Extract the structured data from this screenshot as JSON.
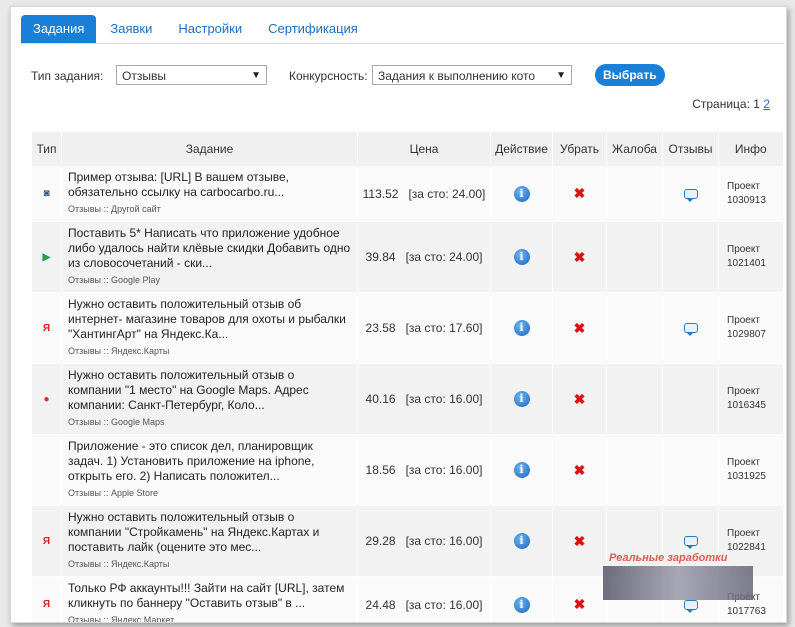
{
  "tabs": [
    {
      "label": "Задания",
      "active": true
    },
    {
      "label": "Заявки",
      "active": false
    },
    {
      "label": "Настройки",
      "active": false
    },
    {
      "label": "Сертификация",
      "active": false
    }
  ],
  "filters": {
    "type_label": "Тип задания:",
    "type_value": "Отзывы",
    "competition_label": "Конкурсность:",
    "competition_value": "Задания к выполнению кото",
    "submit_label": "Выбрать"
  },
  "pagination": {
    "label": "Страница:",
    "current": "1",
    "next": "2"
  },
  "table": {
    "headers": [
      "Тип",
      "Задание",
      "Цена",
      "Действие",
      "Убрать",
      "Жалоба",
      "Отзывы",
      "Инфо"
    ],
    "rows": [
      {
        "icon": "other-site-icon",
        "icon_glyph": "◙",
        "icon_color": "#3a5a8c",
        "text": "Пример отзыва: [URL] В вашем отзыве, обязательно ссылку на carbocarbo.ru...",
        "category": "Отзывы :: Другой сайт",
        "price": "113.52",
        "per100": "[за сто: 24.00]",
        "has_reviews": true,
        "project": "Проект",
        "project_id": "1030913"
      },
      {
        "icon": "google-play-icon",
        "icon_glyph": "▶",
        "icon_color": "#2a9d4a",
        "text": "Поставить 5* Написать что приложение удобное либо удалось найти клёвые скидки Добавить одно из словосочетаний - ски...",
        "category": "Отзывы :: Google Play",
        "price": "39.84",
        "per100": "[за сто: 24.00]",
        "has_reviews": false,
        "project": "Проект",
        "project_id": "1021401"
      },
      {
        "icon": "yandex-icon",
        "icon_glyph": "Я",
        "icon_color": "#e02020",
        "text": "Нужно оставить положительный отзыв об интернет- магазине товаров для охоты и рыбалки \"ХантингАрт\" на Яндекс.Ка...",
        "category": "Отзывы :: Яндекс.Карты",
        "price": "23.58",
        "per100": "[за сто: 17.60]",
        "has_reviews": true,
        "project": "Проект",
        "project_id": "1029807"
      },
      {
        "icon": "map-pin-icon",
        "icon_glyph": "●",
        "icon_color": "#d93025",
        "text": "Нужно оставить положительный отзыв о компании \"1 место\" на Google Maps. Адрес компании: Санкт-Петербург, Коло...",
        "category": "Отзывы :: Google Maps",
        "price": "40.16",
        "per100": "[за сто: 16.00]",
        "has_reviews": false,
        "project": "Проект",
        "project_id": "1016345"
      },
      {
        "icon": "apple-icon",
        "icon_glyph": "",
        "icon_color": "#222222",
        "text": "Приложение - это список дел, планировщик задач. 1) Установить приложение на iphone, открыть его. 2) Написать положител...",
        "category": "Отзывы :: Apple Store",
        "price": "18.56",
        "per100": "[за сто: 16.00]",
        "has_reviews": false,
        "project": "Проект",
        "project_id": "1031925"
      },
      {
        "icon": "yandex-icon",
        "icon_glyph": "Я",
        "icon_color": "#e02020",
        "text": "Нужно оставить положительный отзыв о компании \"Стройкамень\" на Яндекс.Картах и поставить лайк (оцените это мес...",
        "category": "Отзывы :: Яндекс.Карты",
        "price": "29.28",
        "per100": "[за сто: 16.00]",
        "has_reviews": true,
        "project": "Проект",
        "project_id": "1022841"
      },
      {
        "icon": "yandex-icon",
        "icon_glyph": "Я",
        "icon_color": "#e02020",
        "text": "Только РФ аккаунты!!! Зайти на сайт [URL], затем кликнуть по баннеру \"Оставить отзыв\" в ...",
        "category": "Отзывы :: Яндекс.Маркет",
        "price": "24.48",
        "per100": "[за сто: 16.00]",
        "has_reviews": true,
        "project": "Проект",
        "project_id": "1017763"
      }
    ]
  },
  "watermark": {
    "text": "Реальные заработки"
  }
}
